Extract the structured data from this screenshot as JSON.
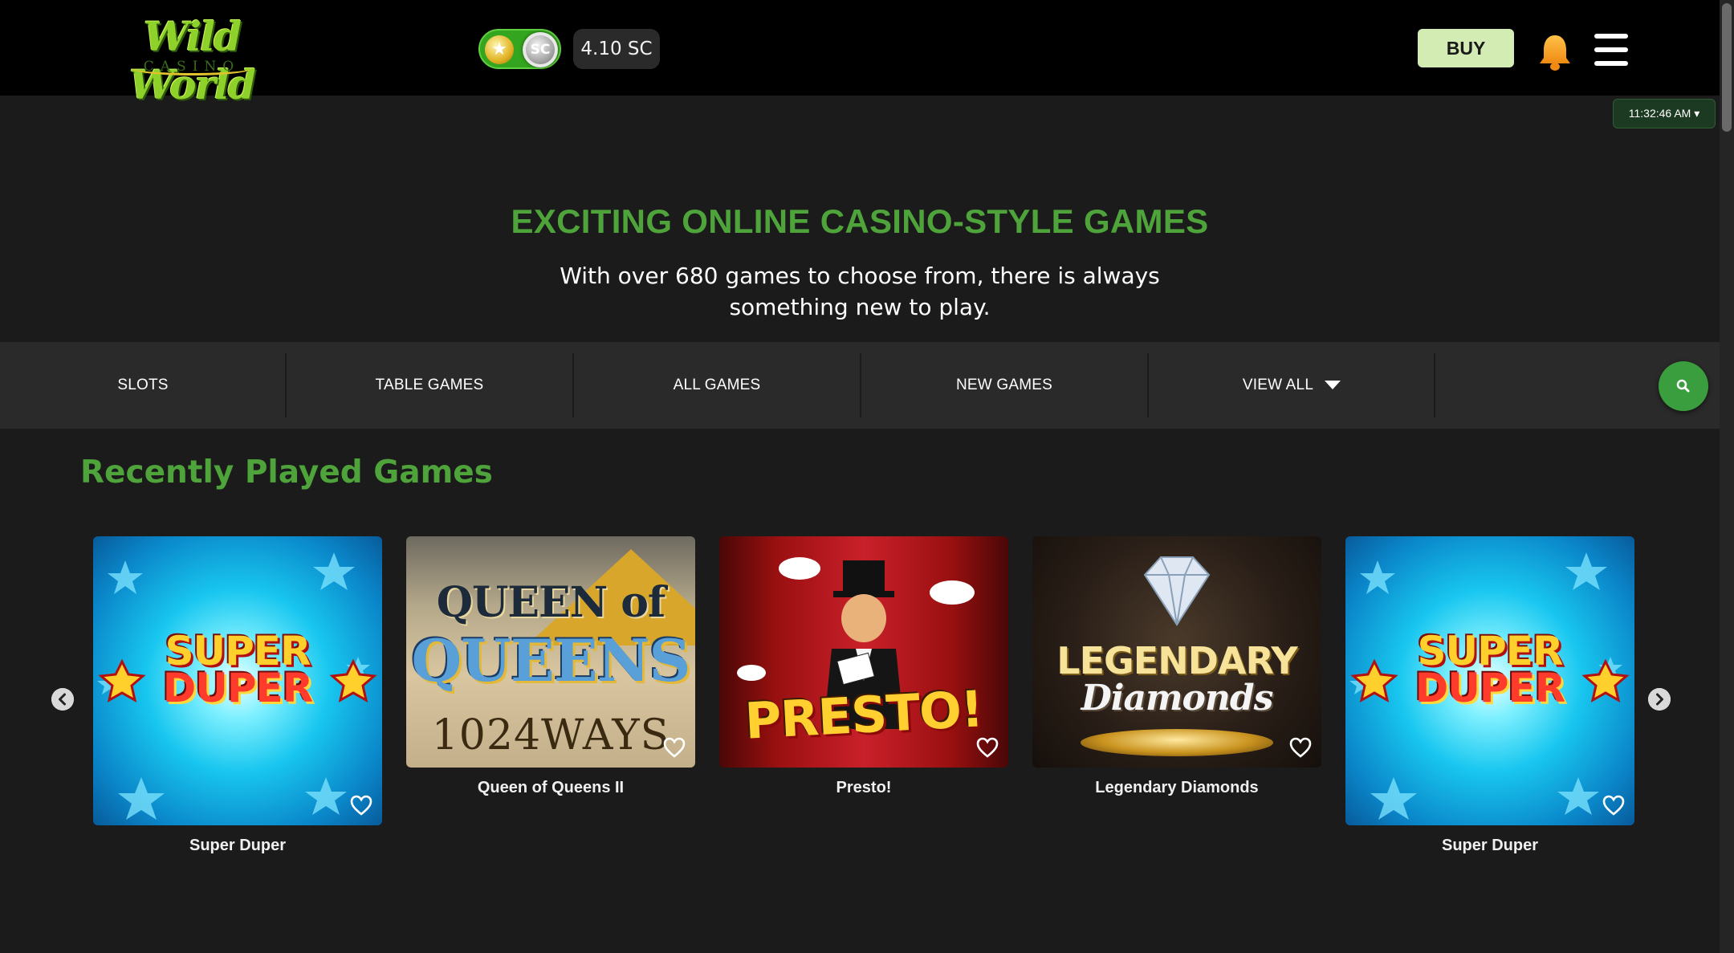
{
  "header": {
    "logo_main": "Wild World",
    "logo_sub": "CASINO",
    "balance": "4.10 SC",
    "toggle_left": "★",
    "toggle_right": "SC",
    "buy_label": "BUY"
  },
  "time": "11:32:46 AM ▾",
  "hero": {
    "title": "EXCITING ONLINE CASINO-STYLE GAMES",
    "subtitle": "With over 680 games to choose from, there is always something new to play."
  },
  "nav": {
    "items": [
      {
        "label": "SLOTS"
      },
      {
        "label": "TABLE GAMES"
      },
      {
        "label": "ALL GAMES"
      },
      {
        "label": "NEW GAMES"
      },
      {
        "label": "VIEW ALL"
      }
    ]
  },
  "recent": {
    "title": "Recently Played Games",
    "games": [
      {
        "name": "Super Duper",
        "art": [
          "SUPER",
          "DUPER"
        ]
      },
      {
        "name": "Queen of Queens II",
        "art": [
          "QUEEN of",
          "QUEENS",
          "1024WAYS"
        ]
      },
      {
        "name": "Presto!",
        "art": [
          "PRESTO!"
        ]
      },
      {
        "name": "Legendary Diamonds",
        "art": [
          "LEGENDARY",
          "Diamonds"
        ]
      },
      {
        "name": "Super Duper",
        "art": [
          "SUPER",
          "DUPER"
        ]
      }
    ]
  },
  "colors": {
    "accent_green": "#4ea33a",
    "buy_bg": "#d2ecb4",
    "header_bg": "#000000",
    "page_bg": "#1b1b1b"
  },
  "icons": {
    "bell": "bell-icon",
    "menu": "hamburger-menu-icon",
    "search": "search-icon",
    "heart": "heart-outline-icon",
    "prev": "chevron-left-icon",
    "next": "chevron-right-icon"
  }
}
